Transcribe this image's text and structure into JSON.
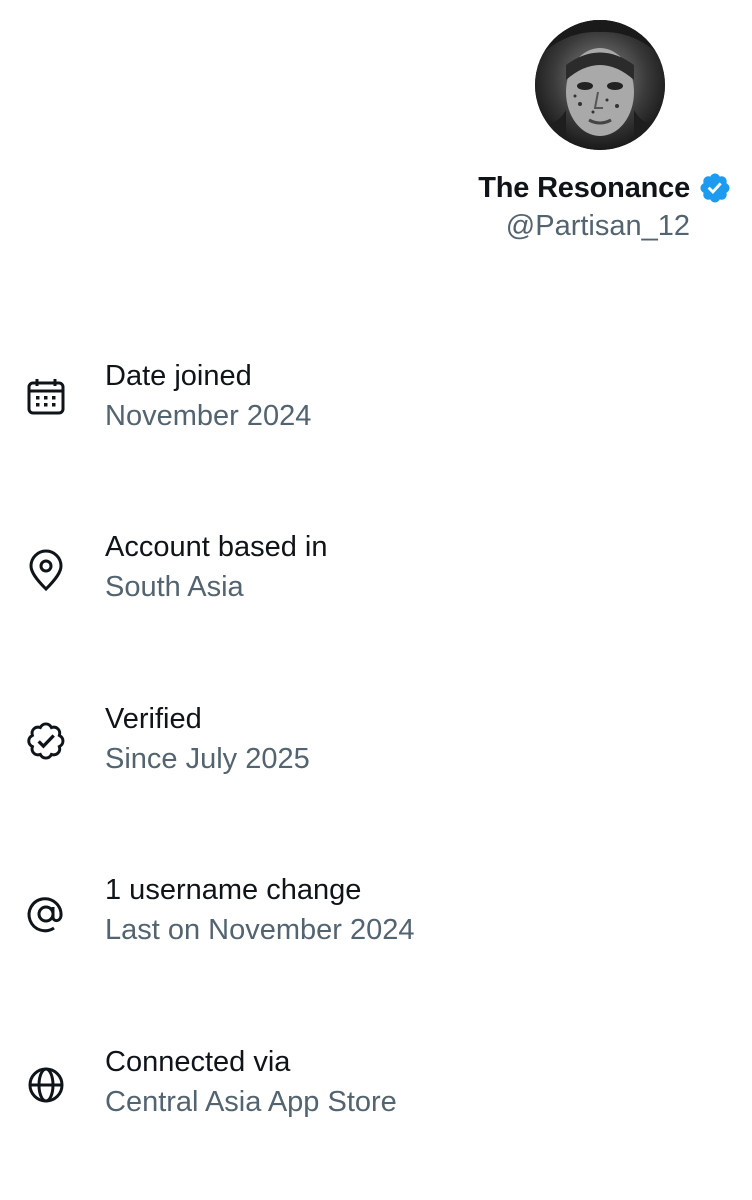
{
  "profile": {
    "display_name": "The Resonance",
    "handle": "@Partisan_12",
    "verified_color": "#1d9bf0"
  },
  "about": {
    "items": [
      {
        "icon": "calendar-icon",
        "title": "Date joined",
        "value": "November 2024"
      },
      {
        "icon": "location-pin-icon",
        "title": "Account based in",
        "value": "South Asia"
      },
      {
        "icon": "verified-badge-icon",
        "title": "Verified",
        "value": "Since July 2025"
      },
      {
        "icon": "at-sign-icon",
        "title": "1 username change",
        "value": "Last on November 2024"
      },
      {
        "icon": "globe-icon",
        "title": "Connected via",
        "value": "Central Asia App Store"
      }
    ]
  }
}
